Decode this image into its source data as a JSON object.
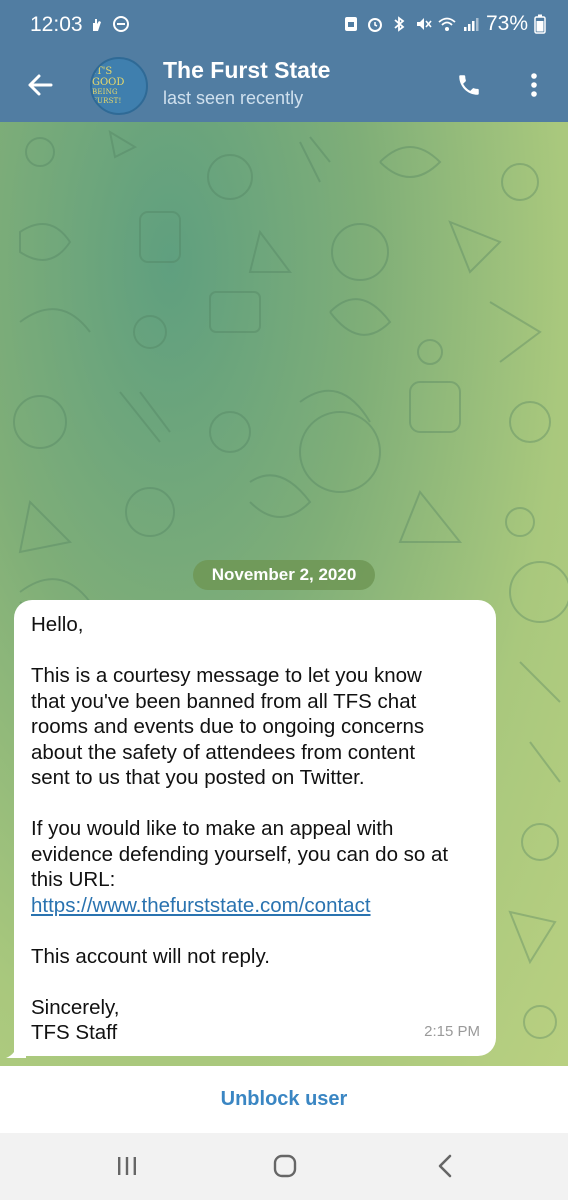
{
  "status_bar": {
    "time": "12:03",
    "battery": "73%",
    "left_icons": [
      "hand-icon",
      "do-not-disturb-icon"
    ],
    "right_icons": [
      "sim-icon",
      "alarm-icon",
      "bluetooth-icon",
      "mute-icon",
      "wifi-icon",
      "signal-icon",
      "battery-icon"
    ]
  },
  "header": {
    "title": "The Furst State",
    "subtitle": "last seen recently",
    "avatar_text_line1": "IT'S GOOD",
    "avatar_text_line2": "BEING FURST!",
    "icons": [
      "back-arrow-icon",
      "phone-icon",
      "more-vert-icon"
    ]
  },
  "chat": {
    "date_chip": "November 2, 2020",
    "message": {
      "greeting": "Hello,",
      "line1": "This is a courtesy message to let you know",
      "line2": "that you've been banned from all TFS chat",
      "line3": "rooms and events due to ongoing concerns",
      "line4": "about the safety of attendees from content",
      "line5": "sent to us that you posted on Twitter.",
      "line6": "If you would like to make an appeal with",
      "line7": "evidence defending yourself, you can do so at",
      "line8": "this URL:",
      "link": "https://www.thefurststate.com/contact",
      "line9": "This account will not reply.",
      "line10": "Sincerely,",
      "line11": "TFS Staff",
      "time": "2:15 PM"
    }
  },
  "footer": {
    "unblock_label": "Unblock user"
  },
  "nav_bar": {
    "icons": [
      "recents-icon",
      "home-icon",
      "back-icon"
    ]
  },
  "colors": {
    "header_bg": "#517da2",
    "link": "#2a73b0",
    "unblock": "#3a86c3",
    "date_chip": "#6e9655"
  }
}
